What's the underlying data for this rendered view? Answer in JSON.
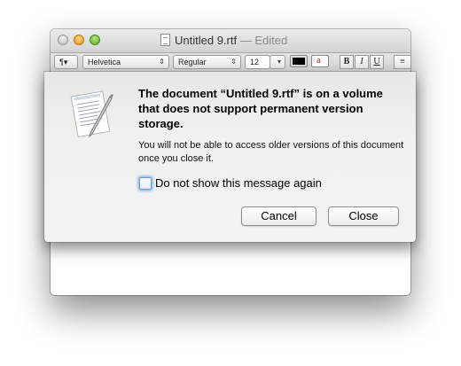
{
  "window": {
    "title": "Untitled 9.rtf",
    "edited_suffix": "— Edited"
  },
  "toolbar": {
    "paragraph_label": "¶▾",
    "font_family": "Helvetica",
    "font_style": "Regular",
    "font_size": "12",
    "bold_label": "B",
    "italic_label": "I",
    "underline_label": "U",
    "text_color": "#000000",
    "highlight_color": "#ffffff"
  },
  "dialog": {
    "heading": "The document “Untitled 9.rtf” is on a volume that does not support permanent version storage.",
    "message": "You will not be able to access older versions of this document once you close it.",
    "checkbox_label": "Do not show this message again",
    "checkbox_checked": false,
    "cancel_label": "Cancel",
    "close_label": "Close",
    "app_icon": "textedit-icon"
  }
}
